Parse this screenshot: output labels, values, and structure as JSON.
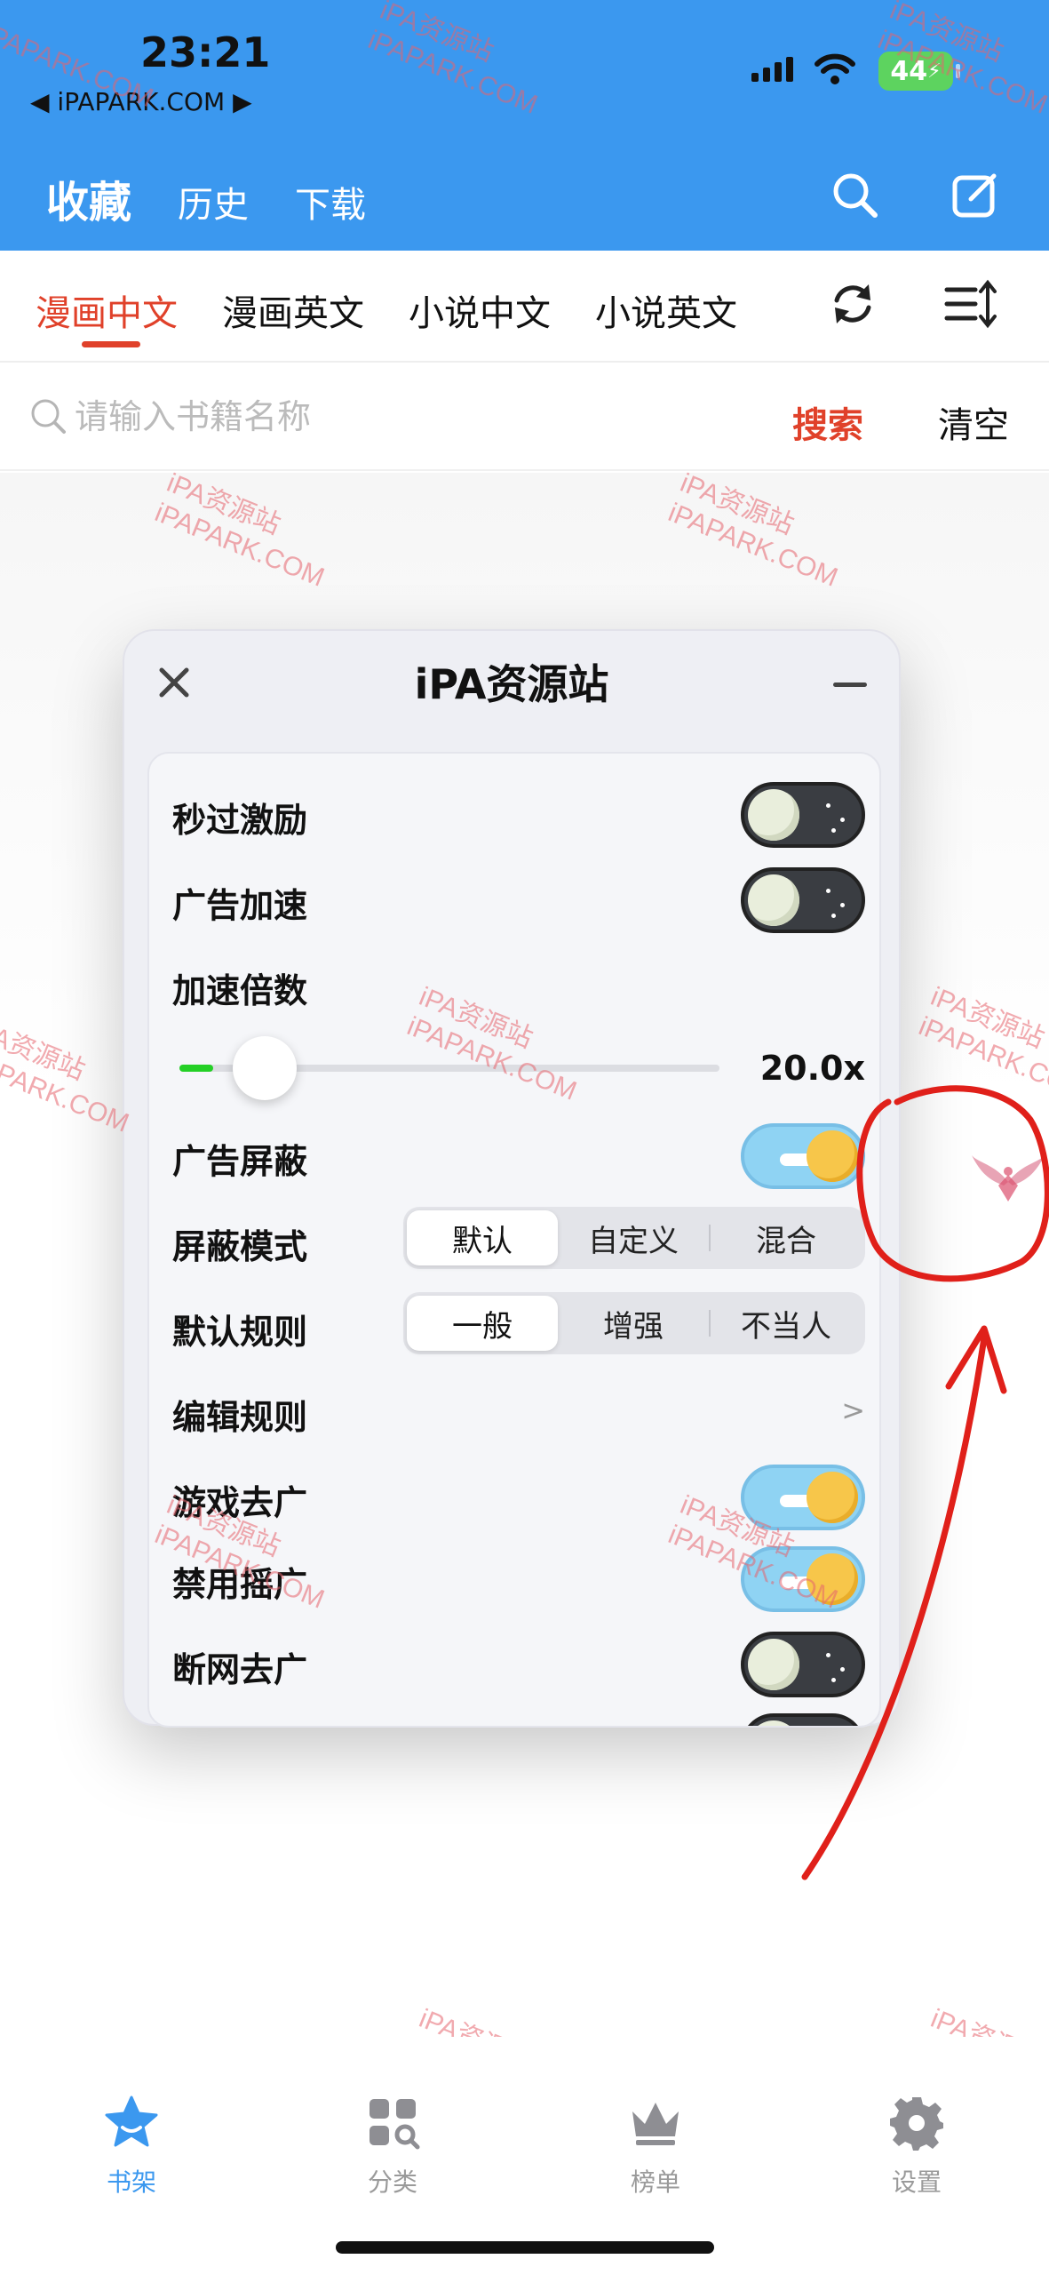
{
  "status_bar": {
    "time": "23:21",
    "back_label": "◀ iPAPARK.COM ▶",
    "battery": "44"
  },
  "header": {
    "tabs": [
      {
        "label": "收藏",
        "active": true
      },
      {
        "label": "历史",
        "active": false
      },
      {
        "label": "下载",
        "active": false
      }
    ],
    "actions": [
      "search-icon",
      "edit-icon"
    ]
  },
  "category_tabs": {
    "items": [
      {
        "label": "漫画中文",
        "active": true
      },
      {
        "label": "漫画英文",
        "active": false
      },
      {
        "label": "小说中文",
        "active": false
      },
      {
        "label": "小说英文",
        "active": false
      }
    ],
    "actions": [
      "refresh-icon",
      "sort-icon"
    ]
  },
  "search": {
    "placeholder": "请输入书籍名称",
    "value": "",
    "search_label": "搜索",
    "clear_label": "清空"
  },
  "panel": {
    "title": "iPA资源站",
    "rows": {
      "skip_reward": {
        "label": "秒过激励",
        "on": false
      },
      "ad_speedup": {
        "label": "广告加速",
        "on": false
      },
      "speed_multiplier": {
        "label": "加速倍数",
        "value": "20.0x",
        "level": 0.05
      },
      "ad_block": {
        "label": "广告屏蔽",
        "on": true
      },
      "block_mode": {
        "label": "屏蔽模式",
        "options": [
          "默认",
          "自定义",
          "混合"
        ],
        "selected": 0
      },
      "default_rule": {
        "label": "默认规则",
        "options": [
          "一般",
          "增强",
          "不当人"
        ],
        "selected": 0
      },
      "edit_rules": {
        "label": "编辑规则",
        "chevron": ">"
      },
      "game_ad_remove": {
        "label": "游戏去广",
        "on": true
      },
      "disable_shake_ad": {
        "label": "禁用摇广",
        "on": true
      },
      "offline_ad_remove": {
        "label": "断网去广",
        "on": false
      }
    }
  },
  "watermark": {
    "line1": "iPA资源站",
    "line2": "iPAPARK.COM"
  },
  "bottom_nav": {
    "items": [
      {
        "label": "书架",
        "icon": "star-icon",
        "active": true
      },
      {
        "label": "分类",
        "icon": "category-icon",
        "active": false
      },
      {
        "label": "榜单",
        "icon": "crown-icon",
        "active": false
      },
      {
        "label": "设置",
        "icon": "gear-icon",
        "active": false
      }
    ]
  },
  "colors": {
    "header_blue": "#3b98ef",
    "accent_red": "#e0412a",
    "slider_green": "#24d026",
    "annotation_red": "#e0201a"
  }
}
